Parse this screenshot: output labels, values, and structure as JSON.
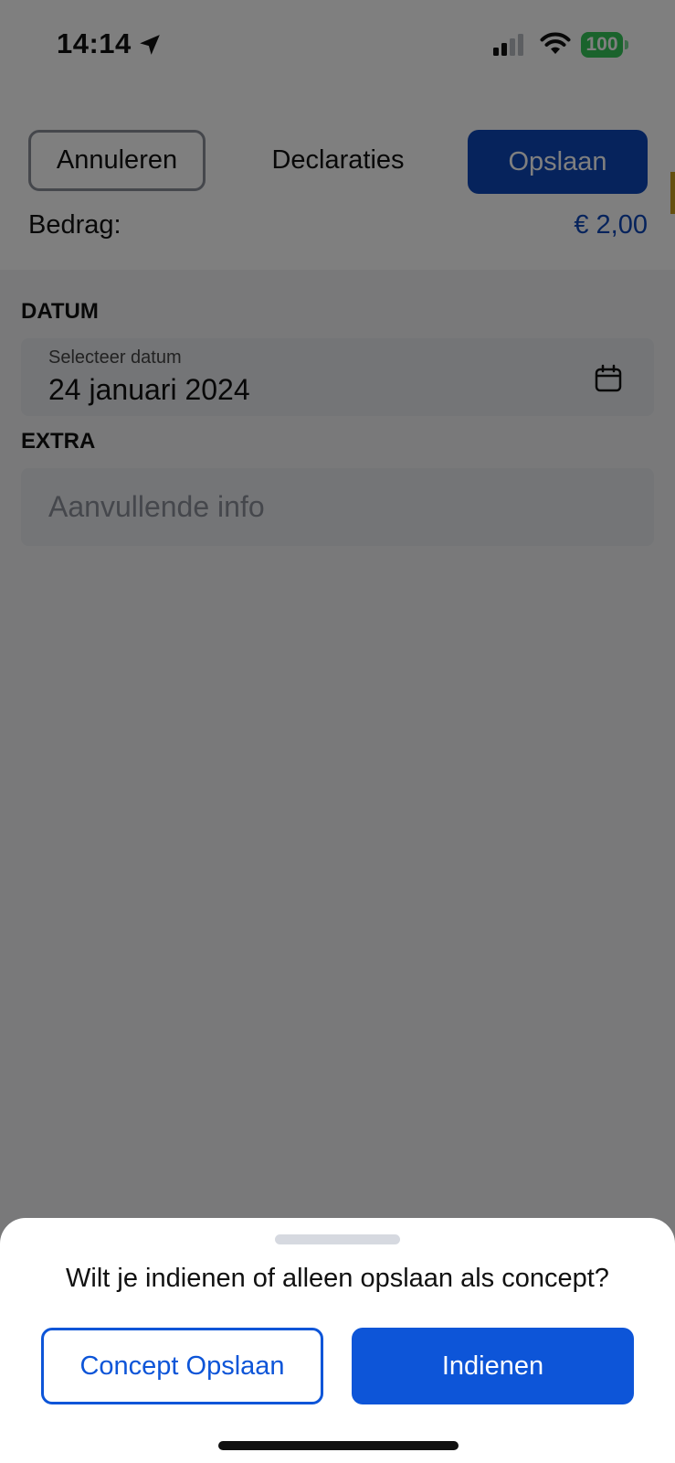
{
  "status_bar": {
    "time": "14:14",
    "battery": "100"
  },
  "header": {
    "cancel_label": "Annuleren",
    "title": "Declaraties",
    "save_label": "Opslaan",
    "amount_label": "Bedrag:",
    "amount_value": "€ 2,00"
  },
  "form": {
    "date_section": "DATUM",
    "date_caption": "Selecteer datum",
    "date_value": "24 januari 2024",
    "extra_section": "EXTRA",
    "extra_placeholder": "Aanvullende info"
  },
  "sheet": {
    "question": "Wilt je indienen of alleen opslaan als concept?",
    "concept_label": "Concept Opslaan",
    "submit_label": "Indienen"
  },
  "colors": {
    "primary": "#0d46b8",
    "sheet_primary": "#0d55d8",
    "battery": "#34c759",
    "overlay": "rgba(0,0,0,0.5)"
  }
}
